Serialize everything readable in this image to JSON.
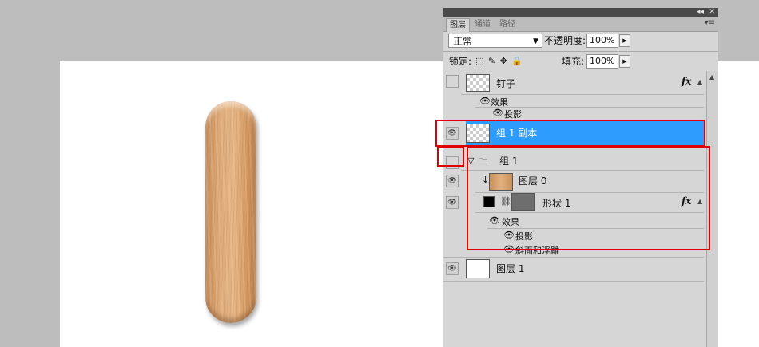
{
  "panel": {
    "tabs": [
      "图层",
      "通道",
      "路径"
    ],
    "titlebar_collapse": "◂◂",
    "titlebar_close": "✕",
    "menu_icon": "▾≡"
  },
  "options": {
    "blend_mode": "正常",
    "opacity_label": "不透明度:",
    "opacity_value": "100%",
    "lock_label": "锁定:",
    "lock_icons": "⬚ ✎ ✥ 🔒",
    "fill_label": "填充:",
    "fill_value": "100%"
  },
  "layers": {
    "nail": {
      "name": "钉子",
      "effects_label": "效果",
      "effect_1": "投影",
      "visible": false
    },
    "group_copy": {
      "name": "组 1 副本",
      "visible": true,
      "selected": true
    },
    "group1": {
      "name": "组 1",
      "visible": false
    },
    "layer0": {
      "name": "图层 0",
      "visible": true
    },
    "shape1": {
      "name": "形状 1",
      "effects_label": "效果",
      "effect_1": "投影",
      "effect_2": "斜面和浮雕",
      "visible": true
    },
    "layer1": {
      "name": "图层 1",
      "visible": true
    }
  },
  "fx_label": "fx",
  "colors": {
    "selection": "#2e9cff",
    "highlight_box": "#e00000",
    "panel_bg": "#d6d6d6"
  }
}
